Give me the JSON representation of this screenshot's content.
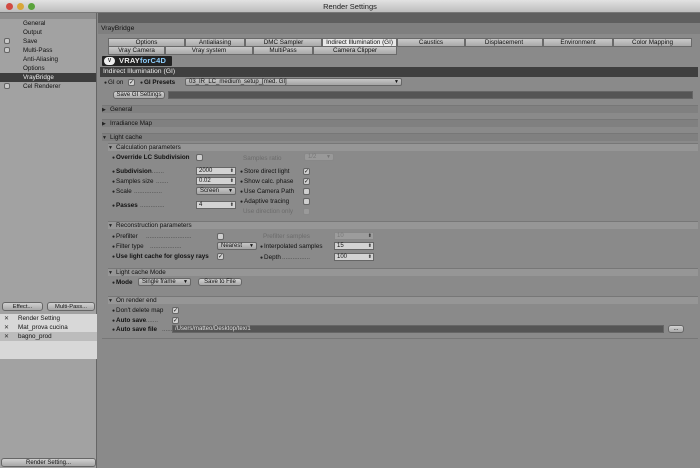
{
  "window": {
    "title": "Render Settings"
  },
  "sidebar": {
    "items": [
      {
        "label": "General",
        "checkbox": false
      },
      {
        "label": "Output",
        "checkbox": false
      },
      {
        "label": "Save",
        "checkbox": true
      },
      {
        "label": "Multi-Pass",
        "checkbox": true
      },
      {
        "label": "Anti-Aliasing",
        "checkbox": false
      },
      {
        "label": "Options",
        "checkbox": false
      },
      {
        "label": "VrayBridge",
        "checkbox": false,
        "selected": true
      },
      {
        "label": "Cel Renderer",
        "checkbox": true
      }
    ],
    "effect_button": "Effect...",
    "multipass_button": "Multi-Pass...",
    "render_settings": [
      {
        "label": "Render Setting"
      },
      {
        "label": "Mat_prova cucina"
      },
      {
        "label": "bagno_prod",
        "selected": true
      }
    ],
    "render_settings_button": "Render Setting..."
  },
  "main": {
    "section_title": "VrayBridge",
    "tabs_row1": [
      "Options",
      "Antialiasing",
      "DMC Sampler",
      "Indirect Illumination (GI)",
      "Caustics",
      "Displacement",
      "Environment",
      "Color Mapping"
    ],
    "tabs_row2": [
      "Vray Camera",
      "Vray system",
      "MultiPass",
      "Camera Clipper"
    ],
    "active_tab": "Indirect Illumination (GI)",
    "logo": {
      "mark": "V",
      "text_a": "VRAY",
      "text_b": "forC4D"
    },
    "gi_title": "Indirect Illumination (GI)",
    "gi_on_label": "GI on",
    "gi_presets_label": "GI Presets",
    "gi_presets_value": "03_IR_LC_medium_setup_[med. GI]",
    "save_gi_button": "Save GI Settings",
    "general_label": "General",
    "irradiance_label": "Irradiance Map",
    "light_cache_label": "Light cache",
    "calc_params_label": "Calculation parameters",
    "override_lc_label": "Override LC Subdivision",
    "samples_ratio_label": "Samples ratio",
    "samples_ratio_value": "1/2",
    "subdivision_label": "Subdivision",
    "subdivision_value": "2000",
    "samples_size_label": "Samples size",
    "samples_size_value": "0.02",
    "scale_label": "Scale",
    "scale_value": "Screen",
    "passes_label": "Passes",
    "passes_value": "4",
    "store_direct_label": "Store direct light",
    "show_calc_label": "Show calc. phase",
    "use_camera_path_label": "Use Camera Path",
    "adaptive_tracing_label": "Adaptive tracing",
    "use_directions_label": "Use direction only",
    "recon_params_label": "Reconstruction parameters",
    "prefilter_label": "Prefilter",
    "prefilter_samples_label": "Prefilter samples",
    "prefilter_samples_value": "10",
    "filter_type_label": "Filter type",
    "filter_type_value": "Nearest",
    "interp_samples_label": "Interpolated samples",
    "interp_samples_value": "15",
    "use_lc_glossy_label": "Use light cache for glossy rays",
    "depth_label": "Depth",
    "depth_value": "100",
    "lc_mode_section": "Light cache Mode",
    "mode_label": "Mode",
    "mode_value": "Single frame",
    "save_to_file_button": "Save to File",
    "on_render_end_label": "On render end",
    "dont_delete_label": "Don't delete map",
    "auto_save_label": "Auto save",
    "auto_save_file_label": "Auto save file",
    "auto_save_file_value": "/Users/matteo/Desktop/tex/1",
    "browse_button": "...",
    "colors": {
      "selected_sidebar": "#3d3d3d",
      "title_bar_dark": "#3f3f3f"
    }
  }
}
